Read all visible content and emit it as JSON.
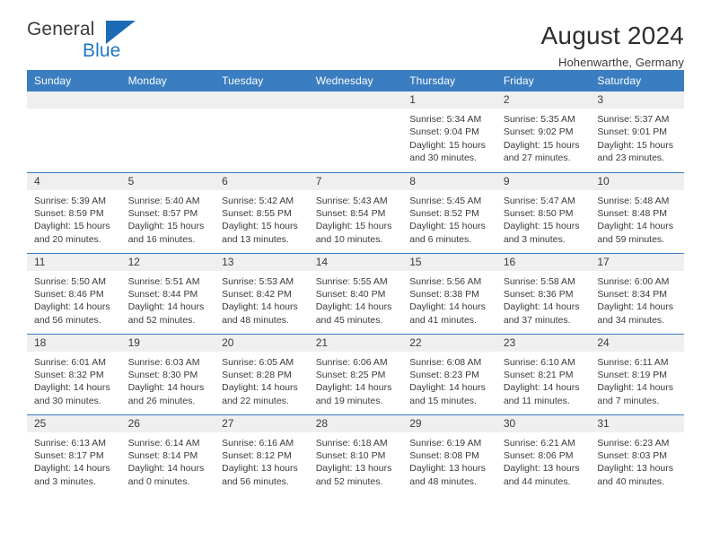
{
  "brand": {
    "name_part1": "General",
    "name_part2": "Blue",
    "logo_icon": "blue-triangle-logo"
  },
  "header": {
    "title": "August 2024",
    "subtitle": "Hohenwarthe, Germany"
  },
  "colors": {
    "header_blue": "#3a7dc0",
    "daynum_band": "#efefef",
    "brand_blue": "#2077c4",
    "text": "#3a3a3a"
  },
  "weekday_headers": [
    "Sunday",
    "Monday",
    "Tuesday",
    "Wednesday",
    "Thursday",
    "Friday",
    "Saturday"
  ],
  "weeks": [
    [
      {
        "day": "",
        "sunrise": "",
        "sunset": "",
        "daylight1": "",
        "daylight2": "",
        "empty": true
      },
      {
        "day": "",
        "sunrise": "",
        "sunset": "",
        "daylight1": "",
        "daylight2": "",
        "empty": true
      },
      {
        "day": "",
        "sunrise": "",
        "sunset": "",
        "daylight1": "",
        "daylight2": "",
        "empty": true
      },
      {
        "day": "",
        "sunrise": "",
        "sunset": "",
        "daylight1": "",
        "daylight2": "",
        "empty": true
      },
      {
        "day": "1",
        "sunrise": "Sunrise: 5:34 AM",
        "sunset": "Sunset: 9:04 PM",
        "daylight1": "Daylight: 15 hours",
        "daylight2": "and 30 minutes."
      },
      {
        "day": "2",
        "sunrise": "Sunrise: 5:35 AM",
        "sunset": "Sunset: 9:02 PM",
        "daylight1": "Daylight: 15 hours",
        "daylight2": "and 27 minutes."
      },
      {
        "day": "3",
        "sunrise": "Sunrise: 5:37 AM",
        "sunset": "Sunset: 9:01 PM",
        "daylight1": "Daylight: 15 hours",
        "daylight2": "and 23 minutes."
      }
    ],
    [
      {
        "day": "4",
        "sunrise": "Sunrise: 5:39 AM",
        "sunset": "Sunset: 8:59 PM",
        "daylight1": "Daylight: 15 hours",
        "daylight2": "and 20 minutes."
      },
      {
        "day": "5",
        "sunrise": "Sunrise: 5:40 AM",
        "sunset": "Sunset: 8:57 PM",
        "daylight1": "Daylight: 15 hours",
        "daylight2": "and 16 minutes."
      },
      {
        "day": "6",
        "sunrise": "Sunrise: 5:42 AM",
        "sunset": "Sunset: 8:55 PM",
        "daylight1": "Daylight: 15 hours",
        "daylight2": "and 13 minutes."
      },
      {
        "day": "7",
        "sunrise": "Sunrise: 5:43 AM",
        "sunset": "Sunset: 8:54 PM",
        "daylight1": "Daylight: 15 hours",
        "daylight2": "and 10 minutes."
      },
      {
        "day": "8",
        "sunrise": "Sunrise: 5:45 AM",
        "sunset": "Sunset: 8:52 PM",
        "daylight1": "Daylight: 15 hours",
        "daylight2": "and 6 minutes."
      },
      {
        "day": "9",
        "sunrise": "Sunrise: 5:47 AM",
        "sunset": "Sunset: 8:50 PM",
        "daylight1": "Daylight: 15 hours",
        "daylight2": "and 3 minutes."
      },
      {
        "day": "10",
        "sunrise": "Sunrise: 5:48 AM",
        "sunset": "Sunset: 8:48 PM",
        "daylight1": "Daylight: 14 hours",
        "daylight2": "and 59 minutes."
      }
    ],
    [
      {
        "day": "11",
        "sunrise": "Sunrise: 5:50 AM",
        "sunset": "Sunset: 8:46 PM",
        "daylight1": "Daylight: 14 hours",
        "daylight2": "and 56 minutes."
      },
      {
        "day": "12",
        "sunrise": "Sunrise: 5:51 AM",
        "sunset": "Sunset: 8:44 PM",
        "daylight1": "Daylight: 14 hours",
        "daylight2": "and 52 minutes."
      },
      {
        "day": "13",
        "sunrise": "Sunrise: 5:53 AM",
        "sunset": "Sunset: 8:42 PM",
        "daylight1": "Daylight: 14 hours",
        "daylight2": "and 48 minutes."
      },
      {
        "day": "14",
        "sunrise": "Sunrise: 5:55 AM",
        "sunset": "Sunset: 8:40 PM",
        "daylight1": "Daylight: 14 hours",
        "daylight2": "and 45 minutes."
      },
      {
        "day": "15",
        "sunrise": "Sunrise: 5:56 AM",
        "sunset": "Sunset: 8:38 PM",
        "daylight1": "Daylight: 14 hours",
        "daylight2": "and 41 minutes."
      },
      {
        "day": "16",
        "sunrise": "Sunrise: 5:58 AM",
        "sunset": "Sunset: 8:36 PM",
        "daylight1": "Daylight: 14 hours",
        "daylight2": "and 37 minutes."
      },
      {
        "day": "17",
        "sunrise": "Sunrise: 6:00 AM",
        "sunset": "Sunset: 8:34 PM",
        "daylight1": "Daylight: 14 hours",
        "daylight2": "and 34 minutes."
      }
    ],
    [
      {
        "day": "18",
        "sunrise": "Sunrise: 6:01 AM",
        "sunset": "Sunset: 8:32 PM",
        "daylight1": "Daylight: 14 hours",
        "daylight2": "and 30 minutes."
      },
      {
        "day": "19",
        "sunrise": "Sunrise: 6:03 AM",
        "sunset": "Sunset: 8:30 PM",
        "daylight1": "Daylight: 14 hours",
        "daylight2": "and 26 minutes."
      },
      {
        "day": "20",
        "sunrise": "Sunrise: 6:05 AM",
        "sunset": "Sunset: 8:28 PM",
        "daylight1": "Daylight: 14 hours",
        "daylight2": "and 22 minutes."
      },
      {
        "day": "21",
        "sunrise": "Sunrise: 6:06 AM",
        "sunset": "Sunset: 8:25 PM",
        "daylight1": "Daylight: 14 hours",
        "daylight2": "and 19 minutes."
      },
      {
        "day": "22",
        "sunrise": "Sunrise: 6:08 AM",
        "sunset": "Sunset: 8:23 PM",
        "daylight1": "Daylight: 14 hours",
        "daylight2": "and 15 minutes."
      },
      {
        "day": "23",
        "sunrise": "Sunrise: 6:10 AM",
        "sunset": "Sunset: 8:21 PM",
        "daylight1": "Daylight: 14 hours",
        "daylight2": "and 11 minutes."
      },
      {
        "day": "24",
        "sunrise": "Sunrise: 6:11 AM",
        "sunset": "Sunset: 8:19 PM",
        "daylight1": "Daylight: 14 hours",
        "daylight2": "and 7 minutes."
      }
    ],
    [
      {
        "day": "25",
        "sunrise": "Sunrise: 6:13 AM",
        "sunset": "Sunset: 8:17 PM",
        "daylight1": "Daylight: 14 hours",
        "daylight2": "and 3 minutes."
      },
      {
        "day": "26",
        "sunrise": "Sunrise: 6:14 AM",
        "sunset": "Sunset: 8:14 PM",
        "daylight1": "Daylight: 14 hours",
        "daylight2": "and 0 minutes."
      },
      {
        "day": "27",
        "sunrise": "Sunrise: 6:16 AM",
        "sunset": "Sunset: 8:12 PM",
        "daylight1": "Daylight: 13 hours",
        "daylight2": "and 56 minutes."
      },
      {
        "day": "28",
        "sunrise": "Sunrise: 6:18 AM",
        "sunset": "Sunset: 8:10 PM",
        "daylight1": "Daylight: 13 hours",
        "daylight2": "and 52 minutes."
      },
      {
        "day": "29",
        "sunrise": "Sunrise: 6:19 AM",
        "sunset": "Sunset: 8:08 PM",
        "daylight1": "Daylight: 13 hours",
        "daylight2": "and 48 minutes."
      },
      {
        "day": "30",
        "sunrise": "Sunrise: 6:21 AM",
        "sunset": "Sunset: 8:06 PM",
        "daylight1": "Daylight: 13 hours",
        "daylight2": "and 44 minutes."
      },
      {
        "day": "31",
        "sunrise": "Sunrise: 6:23 AM",
        "sunset": "Sunset: 8:03 PM",
        "daylight1": "Daylight: 13 hours",
        "daylight2": "and 40 minutes."
      }
    ]
  ]
}
